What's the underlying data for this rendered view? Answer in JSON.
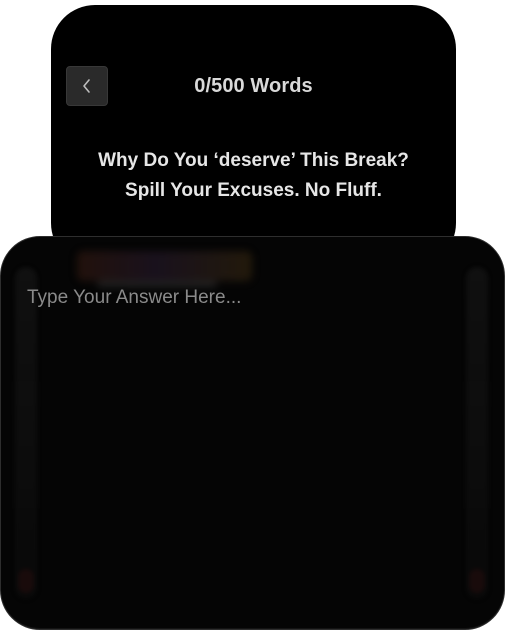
{
  "header": {
    "back_icon": "chevron-left-icon",
    "word_count": "0/500 Words"
  },
  "prompt": {
    "line1": "Why Do You ‘deserve’ This Break?",
    "line2": "Spill Your Excuses. No Fluff."
  },
  "answer": {
    "placeholder": "Type Your Answer Here...",
    "value": ""
  },
  "colors": {
    "card_background": "#000000",
    "text": "#e6e6e6",
    "placeholder": "#8a8a8a"
  }
}
